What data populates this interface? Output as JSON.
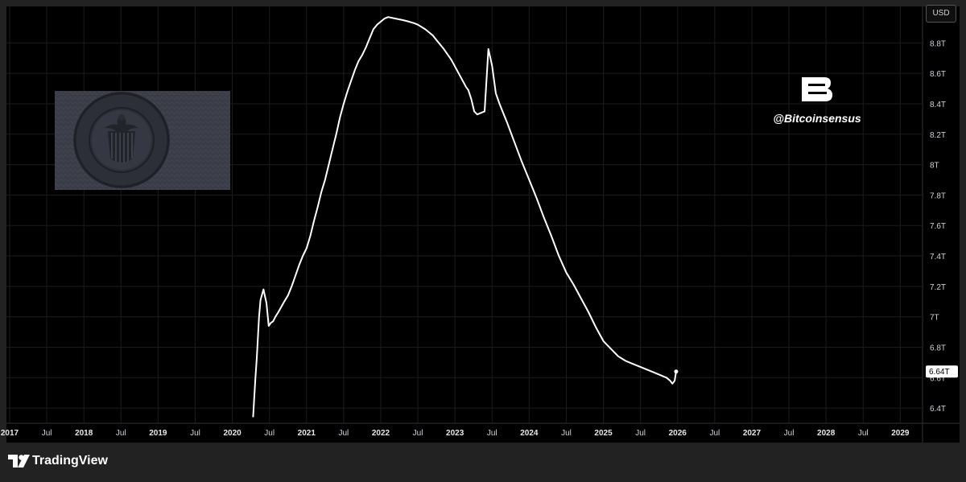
{
  "header": {
    "currency": "USD"
  },
  "branding": {
    "handle": "@Bitcoinsensus",
    "logo_icon": "bitcoinsensus-b-logo-icon",
    "seal_icon": "federal-reserve-seal-icon"
  },
  "footer": {
    "app_name": "TradingView",
    "logo_icon": "tradingview-logo-icon"
  },
  "chart_data": {
    "type": "line",
    "title": "",
    "xlabel": "",
    "ylabel": "",
    "grid": true,
    "background": "#000000",
    "line_color": "#ffffff",
    "xlim": [
      2017.0,
      2029.3
    ],
    "ylim": [
      6.3,
      9.04
    ],
    "y_ticks": [
      6.4,
      6.6,
      6.8,
      7.0,
      7.2,
      7.4,
      7.6,
      7.8,
      8.0,
      8.2,
      8.4,
      8.6,
      8.8
    ],
    "y_tick_labels": [
      "6.4T",
      "6.6T",
      "6.8T",
      "7T",
      "7.2T",
      "7.4T",
      "7.6T",
      "7.8T",
      "8T",
      "8.2T",
      "8.4T",
      "8.6T",
      "8.8T"
    ],
    "x_ticks": [
      {
        "x": 2017.0,
        "label": "2017",
        "bold": true
      },
      {
        "x": 2017.5,
        "label": "Jul",
        "bold": false
      },
      {
        "x": 2018.0,
        "label": "2018",
        "bold": true
      },
      {
        "x": 2018.5,
        "label": "Jul",
        "bold": false
      },
      {
        "x": 2019.0,
        "label": "2019",
        "bold": true
      },
      {
        "x": 2019.5,
        "label": "Jul",
        "bold": false
      },
      {
        "x": 2020.0,
        "label": "2020",
        "bold": true
      },
      {
        "x": 2020.5,
        "label": "Jul",
        "bold": false
      },
      {
        "x": 2021.0,
        "label": "2021",
        "bold": true
      },
      {
        "x": 2021.5,
        "label": "Jul",
        "bold": false
      },
      {
        "x": 2022.0,
        "label": "2022",
        "bold": true
      },
      {
        "x": 2022.5,
        "label": "Jul",
        "bold": false
      },
      {
        "x": 2023.0,
        "label": "2023",
        "bold": true
      },
      {
        "x": 2023.5,
        "label": "Jul",
        "bold": false
      },
      {
        "x": 2024.0,
        "label": "2024",
        "bold": true
      },
      {
        "x": 2024.5,
        "label": "Jul",
        "bold": false
      },
      {
        "x": 2025.0,
        "label": "2025",
        "bold": true
      },
      {
        "x": 2025.5,
        "label": "Jul",
        "bold": false
      },
      {
        "x": 2026.0,
        "label": "2026",
        "bold": true
      },
      {
        "x": 2026.5,
        "label": "Jul",
        "bold": false
      },
      {
        "x": 2027.0,
        "label": "2027",
        "bold": true
      },
      {
        "x": 2027.5,
        "label": "Jul",
        "bold": false
      },
      {
        "x": 2028.0,
        "label": "2028",
        "bold": true
      },
      {
        "x": 2028.5,
        "label": "Jul",
        "bold": false
      },
      {
        "x": 2029.0,
        "label": "2029",
        "bold": true
      }
    ],
    "last_value_label": "6.64T",
    "series": [
      {
        "x": [
          2020.28,
          2020.31,
          2020.33,
          2020.36,
          2020.38,
          2020.42,
          2020.46,
          2020.49,
          2020.52,
          2020.55,
          2020.58,
          2020.62,
          2020.7,
          2020.75,
          2020.8,
          2020.85,
          2020.9,
          2020.95,
          2021.0,
          2021.05,
          2021.1,
          2021.15,
          2021.2,
          2021.25,
          2021.3,
          2021.35,
          2021.4,
          2021.45,
          2021.5,
          2021.55,
          2021.6,
          2021.65,
          2021.7,
          2021.75,
          2021.8,
          2021.85,
          2021.9,
          2021.95,
          2022.0,
          2022.05,
          2022.1,
          2022.2,
          2022.3,
          2022.38,
          2022.45,
          2022.5,
          2022.6,
          2022.7,
          2022.75,
          2022.85,
          2022.95,
          2023.05,
          2023.15,
          2023.18,
          2023.2,
          2023.22,
          2023.24,
          2023.26,
          2023.3,
          2023.35,
          2023.4,
          2023.45,
          2023.5,
          2023.55,
          2023.6,
          2023.7,
          2023.8,
          2023.9,
          2024.0,
          2024.1,
          2024.2,
          2024.3,
          2024.4,
          2024.5,
          2024.6,
          2024.7,
          2024.8,
          2024.9,
          2025.0,
          2025.1,
          2025.2,
          2025.3,
          2025.4,
          2025.5,
          2025.6,
          2025.7,
          2025.8,
          2025.85,
          2025.9,
          2025.93,
          2025.96,
          2025.98
        ],
        "y": [
          6.34,
          6.59,
          6.73,
          7.0,
          7.11,
          7.18,
          7.09,
          6.94,
          6.96,
          6.97,
          7.0,
          7.03,
          7.1,
          7.14,
          7.2,
          7.27,
          7.34,
          7.4,
          7.45,
          7.53,
          7.63,
          7.72,
          7.82,
          7.9,
          8.0,
          8.1,
          8.2,
          8.31,
          8.4,
          8.48,
          8.55,
          8.62,
          8.68,
          8.72,
          8.77,
          8.83,
          8.89,
          8.92,
          8.94,
          8.96,
          8.97,
          8.96,
          8.95,
          8.94,
          8.93,
          8.92,
          8.89,
          8.85,
          8.82,
          8.76,
          8.69,
          8.6,
          8.51,
          8.49,
          8.46,
          8.43,
          8.39,
          8.35,
          8.33,
          8.34,
          8.35,
          8.76,
          8.65,
          8.47,
          8.4,
          8.28,
          8.15,
          8.02,
          7.9,
          7.78,
          7.65,
          7.53,
          7.4,
          7.29,
          7.21,
          7.12,
          7.03,
          6.93,
          6.84,
          6.79,
          6.74,
          6.71,
          6.69,
          6.67,
          6.65,
          6.63,
          6.61,
          6.6,
          6.58,
          6.56,
          6.58,
          6.64
        ]
      }
    ]
  }
}
